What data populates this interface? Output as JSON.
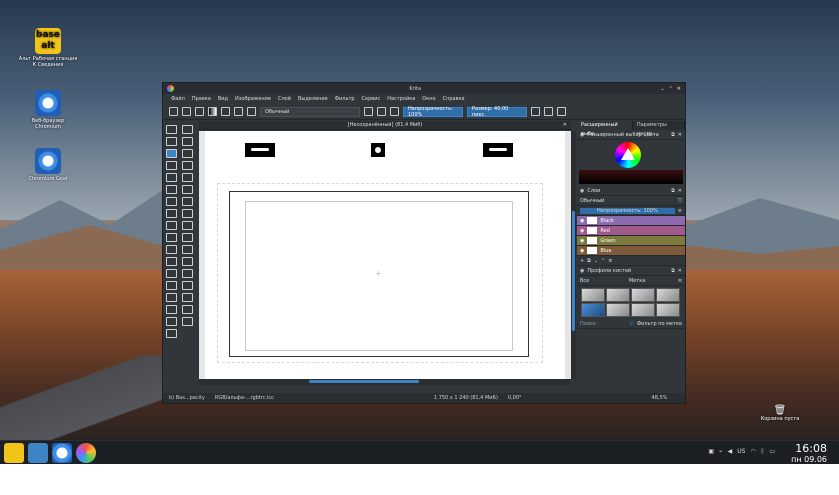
{
  "desktop": {
    "icons": [
      {
        "label": "Альт Рабочая станция К Сведения",
        "icon": "alt-logo-icon"
      },
      {
        "label": "Веб-браузер Chromium",
        "icon": "chromium-icon"
      },
      {
        "label": "Chromium Gost",
        "icon": "chromium-gost-icon"
      }
    ],
    "trash_label": "Корзина пуста"
  },
  "window": {
    "title": "Krita",
    "menu": [
      "Файл",
      "Правка",
      "Вид",
      "Изображение",
      "Слой",
      "Выделение",
      "Фильтр",
      "Сервис",
      "Настройка",
      "Окно",
      "Справка"
    ],
    "toolbar": {
      "blend_mode": "Обычный",
      "opacity": "Непрозрачность: 100%",
      "size": "Размер: 40,00 пикс."
    },
    "document_tab": "[Несохранённый] (81,4 Миб)",
    "status": {
      "brush": "b) Bas...pacity",
      "color_space": "RGB/альфа-...rgbtrc.icc",
      "dimensions": "1 750 x 1 240 (81,4 МиБ)",
      "rotation": "0,00°",
      "zoom": "48,5%"
    },
    "dock": {
      "tabs": [
        "Расширенный выбо...",
        "Параметры инстр..."
      ],
      "color_selector_title": "Расширенный выбор цвета",
      "layers_title": "Слои",
      "layers_blend": "Обычный",
      "layers_opacity": "Непрозрачность: 100%",
      "layers": [
        {
          "name": "Black",
          "color": "#8d6bb0"
        },
        {
          "name": "Red",
          "color": "#a05a8a"
        },
        {
          "name": "Green",
          "color": "#7d7a3d"
        },
        {
          "name": "Blue",
          "color": "#7f5a3a"
        }
      ],
      "presets_title": "Профили кистей",
      "presets_filter": "Все",
      "presets_tag": "Метка",
      "search_placeholder": "Поиск",
      "filter_in_tag": "Фильтр по метке"
    }
  },
  "taskbar": {
    "time": "16:08",
    "date": "пн 09.06",
    "keyboard_layout": "US"
  }
}
